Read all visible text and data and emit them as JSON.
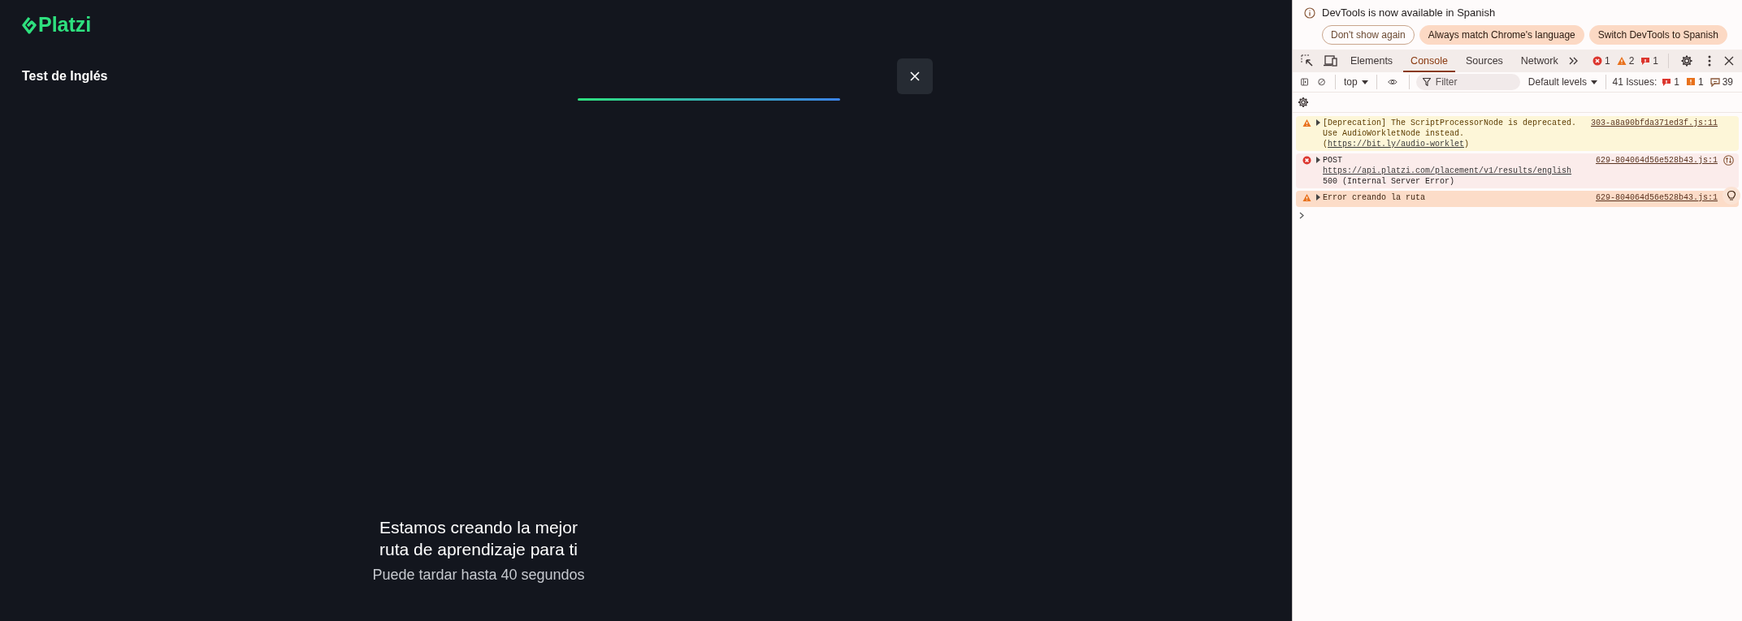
{
  "app": {
    "logo": "Platzi",
    "title": "Test de Inglés",
    "loading": {
      "heading": "Estamos creando la mejor ruta de aprendizaje para ti",
      "subtitle": "Puede tardar hasta 40 segundos"
    }
  },
  "devtools": {
    "infobar": {
      "message": "DevTools is now available in Spanish",
      "buttons": [
        {
          "label": "Don't show again",
          "kind": "outline"
        },
        {
          "label": "Always match Chrome's language",
          "kind": "filled"
        },
        {
          "label": "Switch DevTools to Spanish",
          "kind": "filled"
        }
      ]
    },
    "tabs": [
      {
        "label": "Elements",
        "selected": false
      },
      {
        "label": "Console",
        "selected": true
      },
      {
        "label": "Sources",
        "selected": false
      },
      {
        "label": "Network",
        "selected": false
      }
    ],
    "counters": [
      {
        "kind": "error",
        "count": "1"
      },
      {
        "kind": "warning",
        "count": "2"
      },
      {
        "kind": "issue",
        "count": "1"
      }
    ],
    "toolbar": {
      "context": "top",
      "filter_placeholder": "Filter",
      "levels": "Default levels",
      "issues_label": "41 Issues:",
      "issue_counts": [
        {
          "kind": "error",
          "count": "1"
        },
        {
          "kind": "warning",
          "count": "1"
        },
        {
          "kind": "info",
          "count": "39"
        }
      ]
    },
    "messages": [
      {
        "kind": "warning",
        "highlighted": false,
        "source": "303-a8a90bfda371ed3f.js:11",
        "text": "[Deprecation] The ScriptProcessorNode is deprecated. Use AudioWorkletNode instead. (",
        "link": "https://bit.ly/audio-worklet",
        "text_after": ")"
      },
      {
        "kind": "error",
        "highlighted": false,
        "source": "629-804064d56e528b43.js:1",
        "text": "POST ",
        "link": "https://api.platzi.com/placement/v1/results/english",
        "text_after": " 500 (Internal Server Error)"
      },
      {
        "kind": "warning",
        "highlighted": true,
        "source": "629-804064d56e528b43.js:1",
        "text": "Error creando la ruta"
      }
    ]
  }
}
